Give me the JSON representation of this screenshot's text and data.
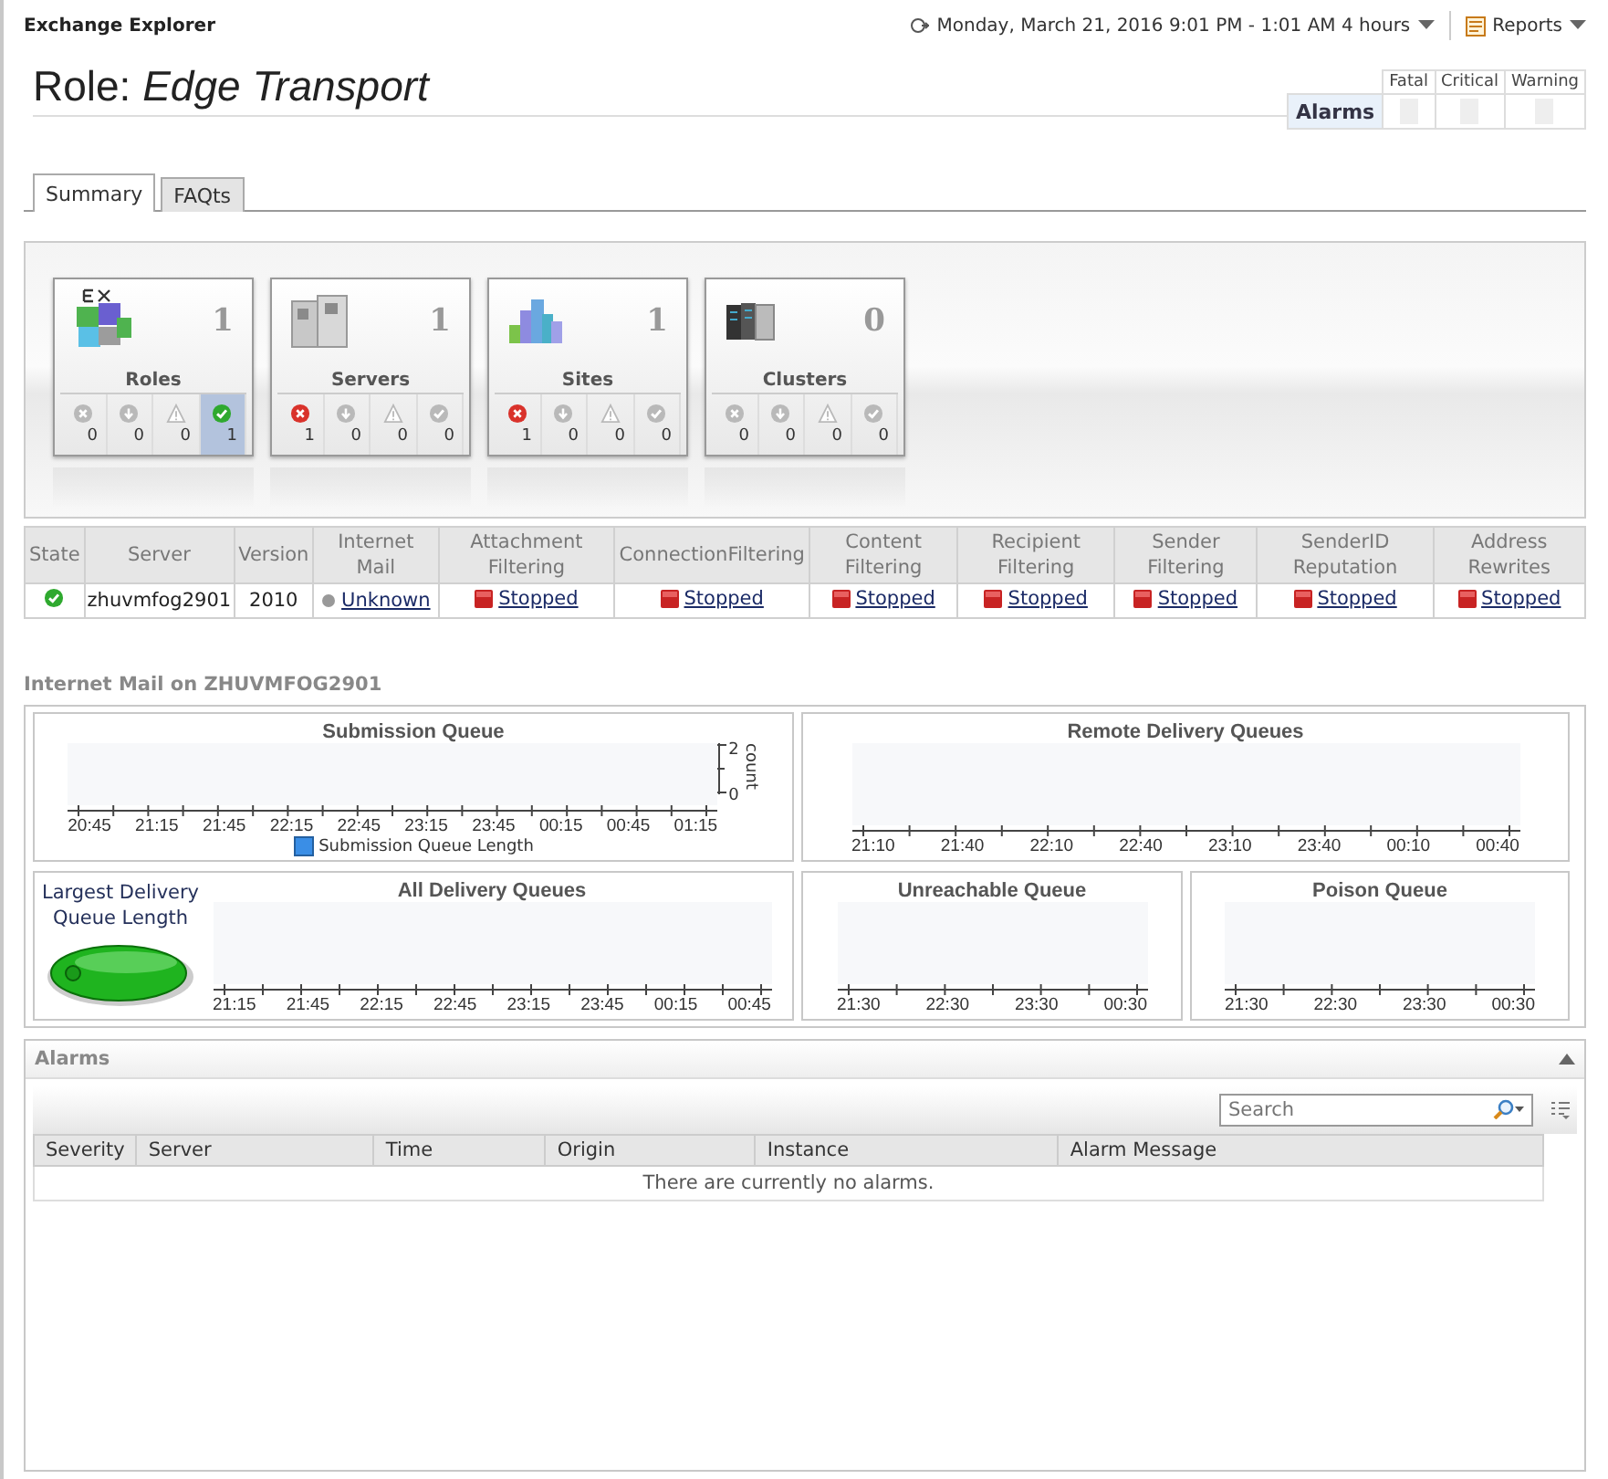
{
  "app_title": "Exchange Explorer",
  "time_range": "Monday, March 21, 2016 9:01 PM - 1:01 AM 4 hours",
  "reports_label": "Reports",
  "page_title": "Role: *Edge Transport*",
  "alarm_summary": {
    "row_label": "Alarms",
    "columns": [
      "Fatal",
      "Critical",
      "Warning"
    ]
  },
  "tabs": [
    {
      "label": "Summary",
      "selected": true
    },
    {
      "label": "FAQts",
      "selected": false
    }
  ],
  "tiles": [
    {
      "kind": "roles",
      "label": "Roles",
      "count": "1",
      "statuses": [
        {
          "kind": "fatal",
          "count": "0",
          "active": false,
          "selected": false
        },
        {
          "kind": "critical",
          "count": "0",
          "active": false,
          "selected": false
        },
        {
          "kind": "warning",
          "count": "0",
          "active": false,
          "selected": false
        },
        {
          "kind": "normal",
          "count": "1",
          "active": true,
          "selected": true
        }
      ]
    },
    {
      "kind": "servers",
      "label": "Servers",
      "count": "1",
      "statuses": [
        {
          "kind": "fatal",
          "count": "1",
          "active": true,
          "selected": false
        },
        {
          "kind": "critical",
          "count": "0",
          "active": false,
          "selected": false
        },
        {
          "kind": "warning",
          "count": "0",
          "active": false,
          "selected": false
        },
        {
          "kind": "normal",
          "count": "0",
          "active": false,
          "selected": false
        }
      ]
    },
    {
      "kind": "sites",
      "label": "Sites",
      "count": "1",
      "statuses": [
        {
          "kind": "fatal",
          "count": "1",
          "active": true,
          "selected": false
        },
        {
          "kind": "critical",
          "count": "0",
          "active": false,
          "selected": false
        },
        {
          "kind": "warning",
          "count": "0",
          "active": false,
          "selected": false
        },
        {
          "kind": "normal",
          "count": "0",
          "active": false,
          "selected": false
        }
      ]
    },
    {
      "kind": "clusters",
      "label": "Clusters",
      "count": "0",
      "statuses": [
        {
          "kind": "fatal",
          "count": "0",
          "active": false,
          "selected": false
        },
        {
          "kind": "critical",
          "count": "0",
          "active": false,
          "selected": false
        },
        {
          "kind": "warning",
          "count": "0",
          "active": false,
          "selected": false
        },
        {
          "kind": "normal",
          "count": "0",
          "active": false,
          "selected": false
        }
      ]
    }
  ],
  "server_table": {
    "columns": [
      "State",
      "Server",
      "Version",
      "Internet Mail",
      "Attachment Filtering",
      "ConnectionFiltering",
      "Content Filtering",
      "Recipient Filtering",
      "Sender Filtering",
      "SenderID Reputation",
      "Address Rewrites"
    ],
    "rows": [
      {
        "state": {
          "kind": "normal"
        },
        "server": "zhuvmfog2901",
        "version": "2010",
        "services": [
          {
            "kind": "unknown",
            "text": "Unknown"
          },
          {
            "kind": "stopped",
            "text": "Stopped"
          },
          {
            "kind": "stopped",
            "text": "Stopped"
          },
          {
            "kind": "stopped",
            "text": "Stopped"
          },
          {
            "kind": "stopped",
            "text": "Stopped"
          },
          {
            "kind": "stopped",
            "text": "Stopped"
          },
          {
            "kind": "stopped",
            "text": "Stopped"
          },
          {
            "kind": "stopped",
            "text": "Stopped"
          }
        ]
      }
    ]
  },
  "section_title": "Internet Mail on ZHUVMFOG2901",
  "charts": [
    {
      "title": "Submission Queue",
      "x_labels": [
        "20:45",
        "21:15",
        "21:45",
        "22:15",
        "22:45",
        "23:15",
        "23:45",
        "00:15",
        "00:45",
        "01:15"
      ],
      "y_labels": [
        "2",
        "0"
      ],
      "y_title": "count",
      "legend": "Submission Queue Length"
    },
    {
      "title": "Remote Delivery Queues",
      "x_labels": [
        "21:10",
        "21:40",
        "22:10",
        "22:40",
        "23:10",
        "23:40",
        "00:10",
        "00:40"
      ]
    },
    {
      "title": "All Delivery Queues",
      "gauge_label": "Largest Delivery Queue Length",
      "x_labels": [
        "21:15",
        "21:45",
        "22:15",
        "22:45",
        "23:15",
        "23:45",
        "00:15",
        "00:45"
      ]
    },
    {
      "title": "Unreachable Queue",
      "x_labels": [
        "21:30",
        "22:30",
        "23:30",
        "00:30"
      ]
    },
    {
      "title": "Poison Queue",
      "x_labels": [
        "21:30",
        "22:30",
        "23:30",
        "00:30"
      ]
    }
  ],
  "alarms": {
    "title": "Alarms",
    "search": {
      "placeholder": "Search"
    },
    "columns": [
      "Severity",
      "Server",
      "Time",
      "Origin",
      "Instance",
      "Alarm Message"
    ],
    "empty_message": "There are currently no alarms."
  }
}
